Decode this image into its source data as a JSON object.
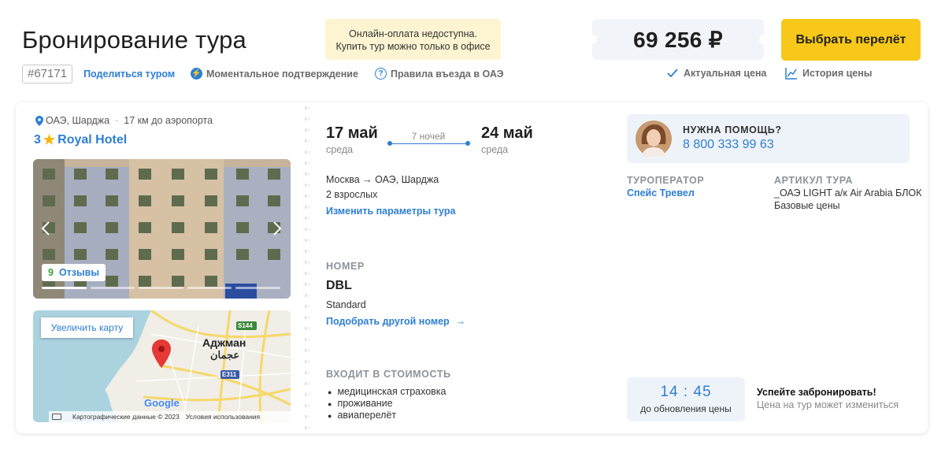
{
  "header": {
    "title": "Бронирование тура",
    "tour_id": "#67171",
    "share_label": "Поделиться туром",
    "instant_confirm": "Моментальное подтверждение",
    "entry_rules": "Правила въезда в ОАЭ",
    "warning_line1": "Онлайн-оплата недоступна.",
    "warning_line2": "Купить тур можно только в офисе",
    "price": "69 256 ₽",
    "select_flight": "Выбрать перелёт",
    "actual_price": "Актуальная цена",
    "price_history": "История цены"
  },
  "hotel": {
    "location": "ОАЭ, Шарджа",
    "separator": "·",
    "airport_distance": "17 км до аэропорта",
    "stars": "3",
    "name": "Royal Hotel",
    "reviews_count": "9",
    "reviews_label": "Отзывы",
    "map_zoom_label": "Увеличить карту",
    "map_city_ru": "Аджман",
    "map_city_ar": "عجمان",
    "map_road1": "S144",
    "map_road2": "E311",
    "map_attrib": "Картографические данные © 2023",
    "map_terms": "Условия использования",
    "map_logo": "Google"
  },
  "trip": {
    "date_from": "17 май",
    "day_from": "среда",
    "nights": "7 ночей",
    "date_to": "24 май",
    "day_to": "среда",
    "route": "Москва → ОАЭ, Шарджа",
    "guests": "2 взрослых",
    "change_params": "Изменить параметры тура",
    "room_label": "НОМЕР",
    "room_type": "DBL",
    "room_category": "Standard",
    "pick_room": "Подобрать другой номер",
    "pick_room_arrow": "→",
    "included_label": "ВХОДИТ В СТОИМОСТЬ",
    "included": [
      "медицинская страховка",
      "проживание",
      "авиаперелёт"
    ]
  },
  "side": {
    "help_title": "НУЖНА ПОМОЩЬ?",
    "help_phone": "8 800 333 99 63",
    "operator_label": "ТУРОПЕРАТОР",
    "operator_name": "Спейс Тревел",
    "article_label": "АРТИКУЛ ТУРА",
    "article_line1": "_ОАЭ LIGHT а/к Air Arabia БЛОК",
    "article_line2": "Базовые цены",
    "timer": "14 : 45",
    "timer_caption": "до обновления цены",
    "hurry_title": "Успейте забронировать!",
    "hurry_sub": "Цена на тур может измениться"
  },
  "colors": {
    "accent": "#2d7fd3",
    "button": "#f7c81a",
    "warning_bg": "#fdf5d2",
    "review_green": "#3aa23a"
  }
}
